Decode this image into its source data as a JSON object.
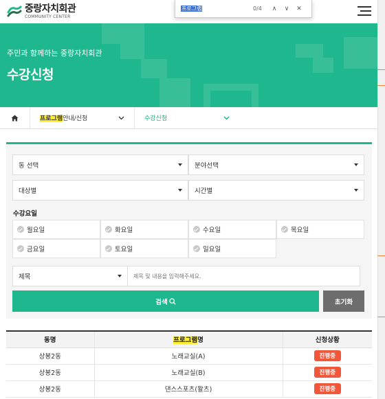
{
  "header": {
    "logo_title": "중랑자치회관",
    "logo_sub": "COMMUNITY CENTER"
  },
  "findbar": {
    "query": "프로그램",
    "count": "0/4",
    "up": "∧",
    "down": "∨",
    "close": "✕"
  },
  "hero": {
    "subtitle": "주민과 함께하는 중랑자치회관",
    "title": "수강신청"
  },
  "breadcrumb": {
    "home_icon": "home-icon",
    "item1_highlight": "프로그램",
    "item1_rest": "안내/신청",
    "item2": "수강신청"
  },
  "filters": {
    "dong": "동 선택",
    "field": "분야선택",
    "target": "대상별",
    "time": "시간별",
    "days_label": "수강요일",
    "days": [
      "월요일",
      "화요일",
      "수요일",
      "목요일",
      "금요일",
      "토요일",
      "일요일"
    ],
    "title_select": "제목",
    "title_placeholder": "제목 및 내용을 입력해주세요.",
    "search_label": "검색",
    "reset_label": "초기화"
  },
  "table": {
    "head_col1": "동명",
    "head_col2_highlight": "프로그램",
    "head_col2_rest": "명",
    "head_col3": "신청상황",
    "rows": [
      {
        "dong": "상봉2동",
        "program": "노래교실(A)",
        "status": "진행중"
      },
      {
        "dong": "상봉2동",
        "program": "노래교실(B)",
        "status": "진행중"
      },
      {
        "dong": "상봉2동",
        "program": "댄스스포츠(왈츠)",
        "status": "진행중"
      }
    ]
  },
  "colors": {
    "brand": "#1fb78d",
    "badge": "#f1573a",
    "highlight": "#ffee32"
  }
}
